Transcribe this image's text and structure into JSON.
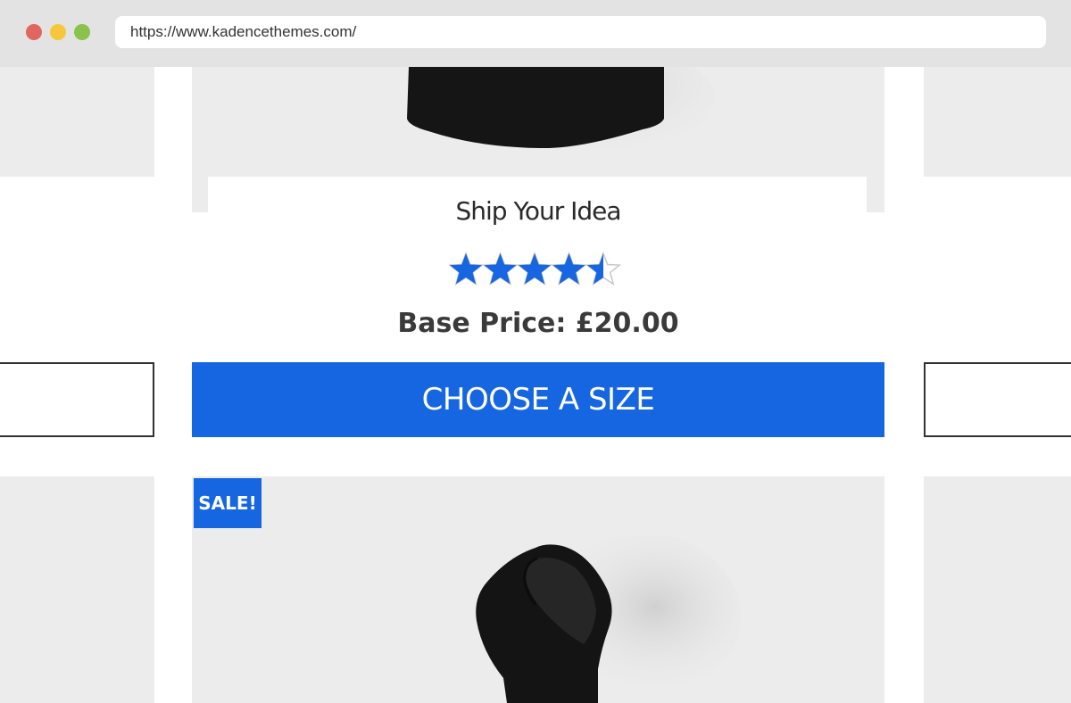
{
  "browser": {
    "url": "https://www.kadencethemes.com/",
    "controls": [
      "close",
      "minimize",
      "maximize"
    ]
  },
  "product": {
    "title": "Ship Your Idea",
    "rating": 4.5,
    "rating_max": 5,
    "price_label": "Base Price: £20.00",
    "cta_label": "CHOOSE A SIZE",
    "image": "black-tshirt"
  },
  "next_product": {
    "badge": "SALE!",
    "image": "black-hoodie"
  },
  "colors": {
    "accent": "#1666e1",
    "panel": "#ececed",
    "chrome": "#e3e3e3",
    "text_dark": "#3a3a3a"
  }
}
